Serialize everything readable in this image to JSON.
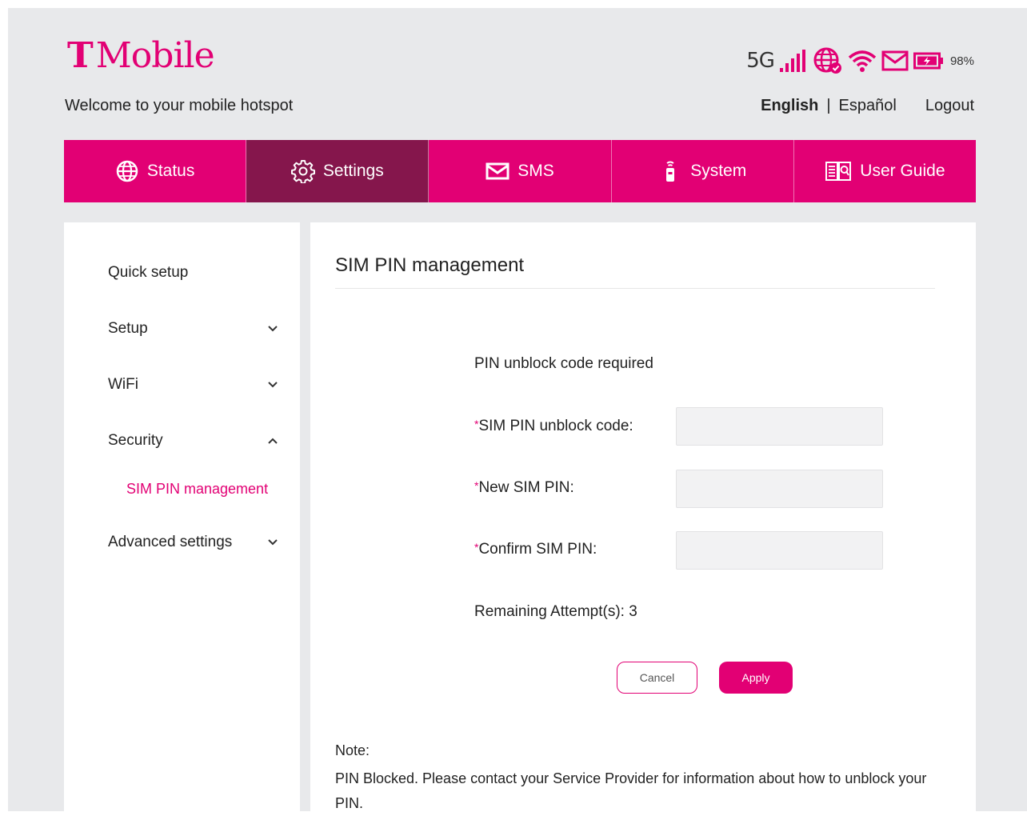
{
  "header": {
    "brand": "Mobile",
    "brand_t": "T",
    "welcome": "Welcome to your mobile hotspot",
    "network_type": "5G",
    "battery_percent": "98%",
    "languages": {
      "english": "English",
      "separator": "|",
      "spanish": "Español"
    },
    "logout": "Logout"
  },
  "nav": {
    "tabs": [
      {
        "label": "Status",
        "icon": "globe-icon"
      },
      {
        "label": "Settings",
        "icon": "gear-icon",
        "active": true
      },
      {
        "label": "SMS",
        "icon": "envelope-icon"
      },
      {
        "label": "System",
        "icon": "device-icon"
      },
      {
        "label": "User Guide",
        "icon": "book-icon"
      }
    ]
  },
  "sidebar": {
    "items": [
      {
        "label": "Quick setup"
      },
      {
        "label": "Setup",
        "chevron": "down"
      },
      {
        "label": "WiFi",
        "chevron": "down"
      },
      {
        "label": "Security",
        "chevron": "up"
      },
      {
        "label": "Advanced settings",
        "chevron": "down"
      }
    ],
    "sub_item": "SIM PIN management"
  },
  "main": {
    "title": "SIM PIN management",
    "form_heading": "PIN unblock code required",
    "required_mark": "*",
    "fields": [
      {
        "label": "SIM PIN unblock code:",
        "value": ""
      },
      {
        "label": "New SIM PIN:",
        "value": ""
      },
      {
        "label": "Confirm SIM PIN:",
        "value": ""
      }
    ],
    "remaining": "Remaining Attempt(s): 3",
    "cancel_label": "Cancel",
    "apply_label": "Apply",
    "note_label": "Note:",
    "note_text": "PIN Blocked. Please contact your Service Provider for information about how to unblock your PIN."
  },
  "colors": {
    "brand": "#e20074",
    "active_tab": "#85164c",
    "background": "#e8e9eb"
  }
}
